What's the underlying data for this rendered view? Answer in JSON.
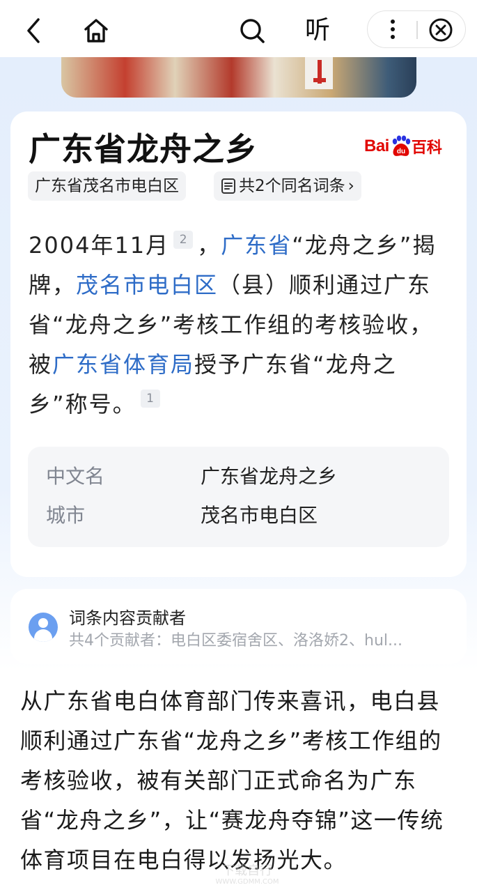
{
  "topbar": {
    "listen_label": "听",
    "icons": [
      "back-arrow-icon",
      "home-icon",
      "search-icon",
      "more-vertical-icon",
      "close-circle-icon"
    ]
  },
  "entry": {
    "title": "广东省龙舟之乡",
    "logo": {
      "bai": "Bai",
      "du": "du",
      "baike": "百科"
    },
    "location_tag": "广东省茂名市电白区",
    "same_name_label": "共2个同名词条",
    "same_name_arrow": "›"
  },
  "summary": {
    "date": "2004年11月",
    "ref1": "2",
    "comma1": "，",
    "link1": "广东省",
    "t1": "“龙舟之乡”揭牌，",
    "link2": "茂名市电白区",
    "t2": "（县）顺利通过广东省“龙舟之乡”考核工作组的考核验收，被",
    "link3": "广东省体育局",
    "t3": "授予广东省“龙舟之乡”称号。",
    "ref2": "1"
  },
  "infobox": [
    {
      "key": "中文名",
      "value": "广东省龙舟之乡"
    },
    {
      "key": "城市",
      "value": "茂名市电白区"
    }
  ],
  "contributors": {
    "title": "词条内容贡献者",
    "summary": "共4个贡献者：电白区委宿舍区、洛洛娇2、hul..."
  },
  "body": {
    "paragraph": "从广东省电白体育部门传来喜讯，电白县顺利通过广东省“龙舟之乡”考核工作组的考核验收，被有关部门正式命名为广东省“龙舟之乡”，让“赛龙舟夺锦”这一传统体育项目在电白得以发扬光大。"
  },
  "watermark": {
    "text": "下载自行",
    "url": "WWW.GDMM.COM"
  },
  "colors": {
    "link": "#2e6cc7",
    "brand_red": "#e10602",
    "page_bg": "#e4eefc"
  }
}
